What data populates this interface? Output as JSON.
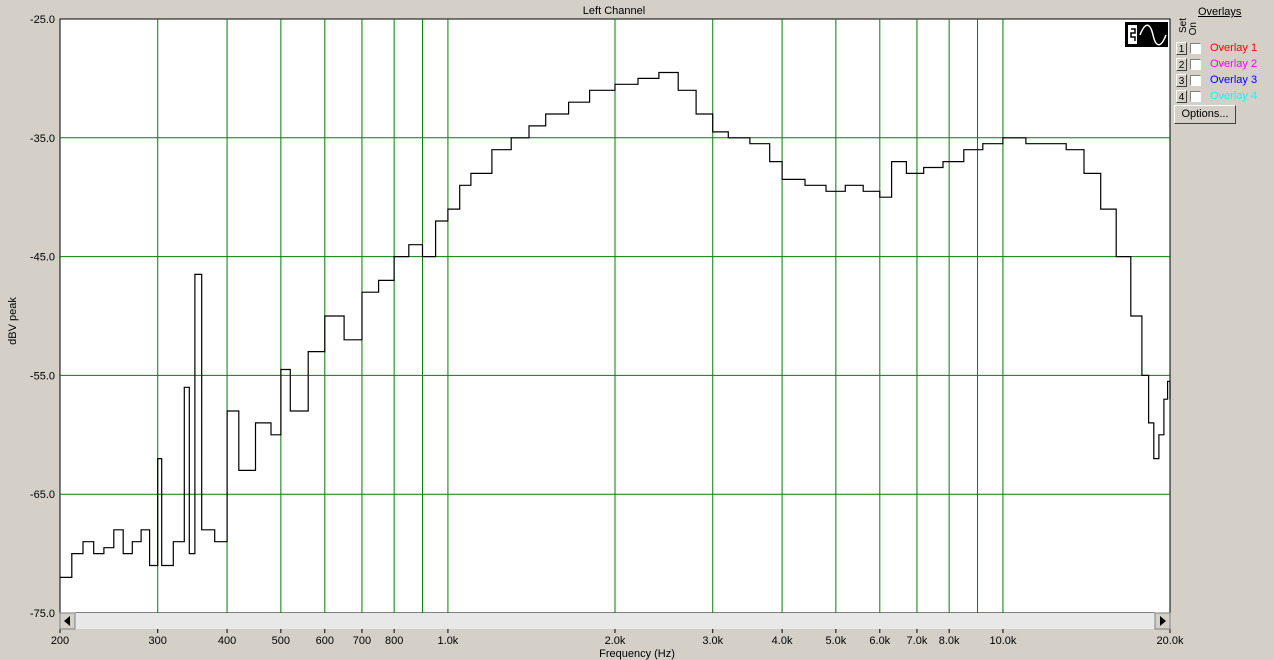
{
  "window": {
    "title": "Left Channel"
  },
  "overlays": {
    "title": "Overlays",
    "col_set": "Set",
    "col_on": "On",
    "items": [
      {
        "num": "1",
        "label": "Overlay 1",
        "color": "#ff0000",
        "checked": false
      },
      {
        "num": "2",
        "label": "Overlay 2",
        "color": "#ff00ff",
        "checked": false
      },
      {
        "num": "3",
        "label": "Overlay 3",
        "color": "#0000ff",
        "checked": false
      },
      {
        "num": "4",
        "label": "Overlay 4",
        "color": "#00ffff",
        "checked": false
      }
    ],
    "options_label": "Options..."
  },
  "display_mode_icon": "sine-wave-display-icon",
  "colors": {
    "grid": "#008000",
    "trace": "#000000",
    "plot_bg": "#ffffff",
    "window_bg": "#d4d0c8"
  },
  "chart_data": {
    "type": "line",
    "title": "Left Channel",
    "xlabel": "Frequency (Hz)",
    "ylabel": "dBV peak",
    "xscale": "log",
    "xlim": [
      200,
      20000
    ],
    "ylim": [
      -75,
      -25
    ],
    "grid": true,
    "y_ticks": [
      -25,
      -35,
      -45,
      -55,
      -65,
      -75
    ],
    "y_tick_labels": [
      "-25.0",
      "-35.0",
      "-45.0",
      "-55.0",
      "-65.0",
      "-75.0"
    ],
    "x_gridlines": [
      300,
      400,
      500,
      600,
      700,
      800,
      900,
      1000,
      2000,
      3000,
      4000,
      5000,
      6000,
      7000,
      8000,
      9000,
      10000
    ],
    "x_ticks": [
      200,
      300,
      400,
      500,
      600,
      700,
      800,
      1000,
      2000,
      3000,
      4000,
      5000,
      6000,
      7000,
      8000,
      10000,
      20000
    ],
    "x_tick_labels": [
      "200",
      "300",
      "400",
      "500",
      "600",
      "700",
      "800",
      "1.0k",
      "2.0k",
      "3.0k",
      "4.0k",
      "5.0k",
      "6.0k",
      "7.0k",
      "8.0k",
      "10.0k",
      "20.0k"
    ],
    "series": [
      {
        "points": [
          [
            200,
            -72
          ],
          [
            210,
            -70
          ],
          [
            220,
            -69
          ],
          [
            230,
            -70
          ],
          [
            240,
            -69.5
          ],
          [
            250,
            -68
          ],
          [
            260,
            -70
          ],
          [
            270,
            -69
          ],
          [
            280,
            -68
          ],
          [
            290,
            -71
          ],
          [
            300,
            -62
          ],
          [
            305,
            -71
          ],
          [
            320,
            -69
          ],
          [
            335,
            -56
          ],
          [
            342,
            -70
          ],
          [
            350,
            -46.5
          ],
          [
            360,
            -68
          ],
          [
            380,
            -69
          ],
          [
            400,
            -58
          ],
          [
            420,
            -63
          ],
          [
            450,
            -59
          ],
          [
            480,
            -60
          ],
          [
            500,
            -54.5
          ],
          [
            520,
            -58
          ],
          [
            560,
            -53
          ],
          [
            600,
            -50
          ],
          [
            650,
            -52
          ],
          [
            700,
            -48
          ],
          [
            750,
            -47
          ],
          [
            800,
            -45
          ],
          [
            850,
            -44
          ],
          [
            900,
            -45
          ],
          [
            950,
            -42
          ],
          [
            1000,
            -41
          ],
          [
            1050,
            -39
          ],
          [
            1100,
            -38
          ],
          [
            1200,
            -36
          ],
          [
            1300,
            -35
          ],
          [
            1400,
            -34
          ],
          [
            1500,
            -33
          ],
          [
            1650,
            -32
          ],
          [
            1800,
            -31
          ],
          [
            2000,
            -30.5
          ],
          [
            2200,
            -30
          ],
          [
            2400,
            -29.5
          ],
          [
            2600,
            -31
          ],
          [
            2800,
            -33
          ],
          [
            3000,
            -34.5
          ],
          [
            3200,
            -35
          ],
          [
            3500,
            -35.5
          ],
          [
            3800,
            -37
          ],
          [
            4000,
            -38.5
          ],
          [
            4400,
            -39
          ],
          [
            4800,
            -39.5
          ],
          [
            5200,
            -39
          ],
          [
            5600,
            -39.5
          ],
          [
            6000,
            -40
          ],
          [
            6300,
            -37
          ],
          [
            6700,
            -38
          ],
          [
            7200,
            -37.5
          ],
          [
            7800,
            -37
          ],
          [
            8500,
            -36
          ],
          [
            9200,
            -35.5
          ],
          [
            10000,
            -35
          ],
          [
            11000,
            -35.5
          ],
          [
            12000,
            -35.5
          ],
          [
            13000,
            -36
          ],
          [
            14000,
            -38
          ],
          [
            15000,
            -41
          ],
          [
            16000,
            -45
          ],
          [
            17000,
            -50
          ],
          [
            17800,
            -55
          ],
          [
            18300,
            -59
          ],
          [
            18700,
            -62
          ],
          [
            19100,
            -60
          ],
          [
            19500,
            -57
          ],
          [
            19800,
            -55.5
          ],
          [
            20000,
            -57
          ]
        ]
      }
    ]
  }
}
